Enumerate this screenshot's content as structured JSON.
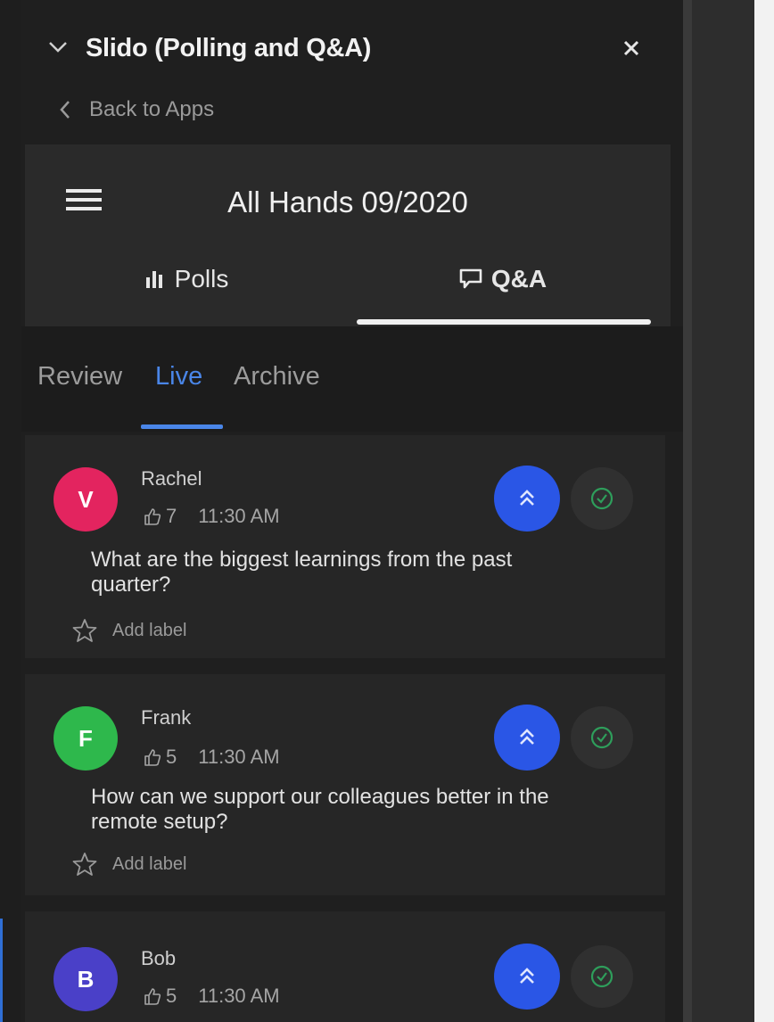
{
  "app": {
    "title": "Slido (Polling and Q&A)",
    "back_label": "Back to Apps"
  },
  "event": {
    "title": "All Hands 09/2020"
  },
  "tabs": [
    {
      "label": "Polls",
      "icon": "bar-chart-icon",
      "active": false
    },
    {
      "label": "Q&A",
      "icon": "speech-bubble-icon",
      "active": true
    }
  ],
  "subtabs": [
    {
      "label": "Review",
      "active": false
    },
    {
      "label": "Live",
      "active": true
    },
    {
      "label": "Archive",
      "active": false
    }
  ],
  "questions": [
    {
      "initial": "V",
      "author": "Rachel",
      "likes": "7",
      "time": "11:30 AM",
      "text": "What are the biggest learnings from the past quarter?",
      "label_action": "Add label",
      "avatar_color": "#e3245f"
    },
    {
      "initial": "F",
      "author": "Frank",
      "likes": "5",
      "time": "11:30 AM",
      "text": "How can we support our colleagues better in the remote setup?",
      "label_action": "Add label",
      "avatar_color": "#2eb84c"
    },
    {
      "initial": "B",
      "author": "Bob",
      "likes": "5",
      "time": "11:30 AM",
      "text": "",
      "label_action": "",
      "avatar_color": "#4a40c8"
    }
  ],
  "colors": {
    "accent": "#4a86e8",
    "upvote": "#2a56e6",
    "approve": "#2e9e5b",
    "panel_bg": "#1f1f1f"
  }
}
